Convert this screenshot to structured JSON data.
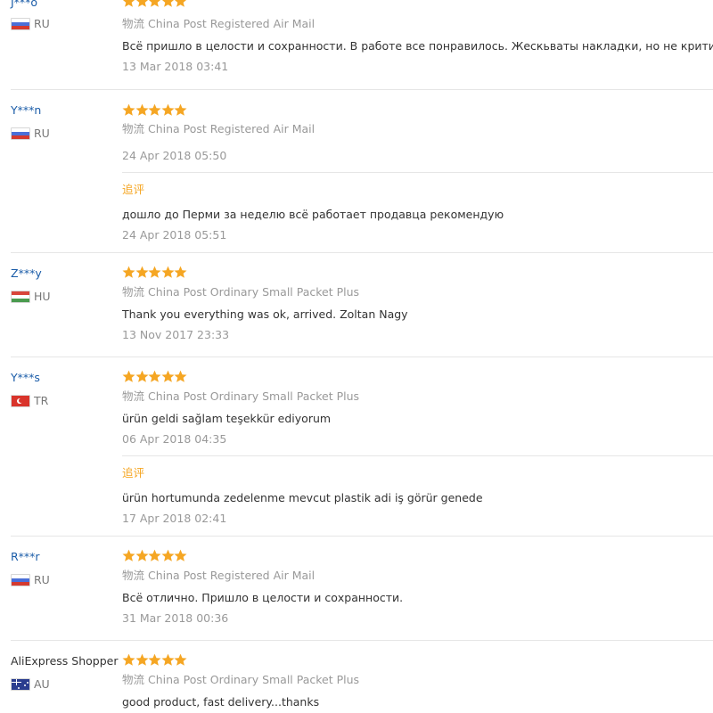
{
  "colors": {
    "star": "#f5a623",
    "username": "#1a5ca8",
    "muted": "#999999",
    "text": "#333333",
    "followup": "#f5a623"
  },
  "icons": {
    "rating": "star-icon"
  },
  "logistics_label": "物流",
  "followup_label": "追评",
  "reviews": [
    {
      "user": "J***o",
      "country": "RU",
      "flag": "russia-flag-icon",
      "rating": 5,
      "shipping": "China Post Registered Air Mail",
      "text": "Всё пришло в целости и сохранности. В работе все понравилось. Жескьваты накладки, но не критично.",
      "date": "13 Mar 2018 03:41"
    },
    {
      "user": "Y***n",
      "country": "RU",
      "flag": "russia-flag-icon",
      "rating": 5,
      "shipping": "China Post Registered Air Mail",
      "text": "",
      "date": "24 Apr 2018 05:50",
      "followup": {
        "text": "дошло до Перми за неделю всё работает продавца рекомендую",
        "date": "24 Apr 2018 05:51"
      }
    },
    {
      "user": "Z***y",
      "country": "HU",
      "flag": "hungary-flag-icon",
      "rating": 5,
      "shipping": "China Post Ordinary Small Packet Plus",
      "text": "Thank you everything was ok, arrived. Zoltan Nagy",
      "date": "13 Nov 2017 23:33"
    },
    {
      "user": "Y***s",
      "country": "TR",
      "flag": "turkey-flag-icon",
      "rating": 5,
      "shipping": "China Post Ordinary Small Packet Plus",
      "text": "ürün geldi sağlam teşekkür ediyorum",
      "date": "06 Apr 2018 04:35",
      "followup": {
        "text": "ürün hortumunda zedelenme mevcut plastik adi iş görür genede",
        "date": "17 Apr 2018 02:41"
      }
    },
    {
      "user": "R***r",
      "country": "RU",
      "flag": "russia-flag-icon",
      "rating": 5,
      "shipping": "China Post Registered Air Mail",
      "text": "Всё отлично. Пришло в целости и сохранности.",
      "date": "31 Mar 2018 00:36"
    },
    {
      "user": "AliExpress Shopper",
      "country": "AU",
      "flag": "australia-flag-icon",
      "rating": 5,
      "shipping": "China Post Ordinary Small Packet Plus",
      "text": "good product, fast delivery...thanks",
      "date": ""
    }
  ]
}
